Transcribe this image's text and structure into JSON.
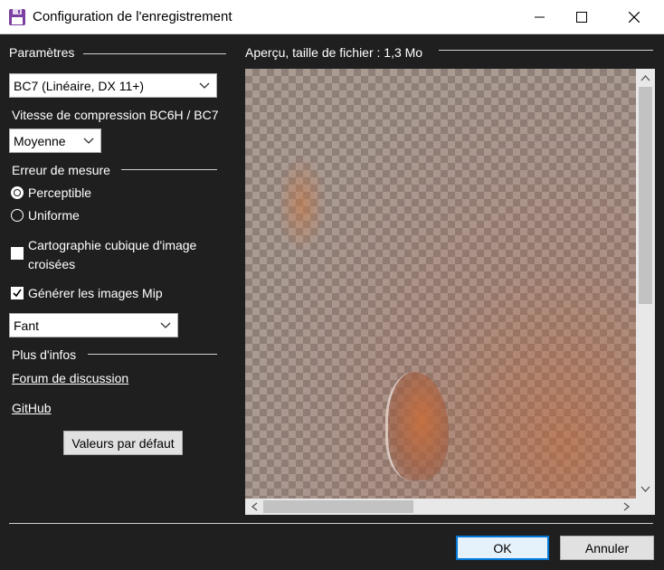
{
  "window": {
    "title": "Configuration de l'enregistrement"
  },
  "settings": {
    "group_title": "Paramètres",
    "format_select": "BC7 (Linéaire, DX 11+)",
    "speed_label": "Vitesse de compression BC6H / BC7",
    "speed_select": "Moyenne",
    "error_group_title": "Erreur de mesure",
    "error_options": [
      {
        "label": "Perceptible",
        "checked": true
      },
      {
        "label": "Uniforme",
        "checked": false
      }
    ],
    "cubemap_label_line1": "Cartographie cubique d'image",
    "cubemap_label_line2": "croisées",
    "cubemap_checked": false,
    "mip_label": "Générer les images Mip",
    "mip_checked": true,
    "filter_select": "Fant",
    "info_group_title": "Plus d'infos",
    "forum_link": "Forum de discussion",
    "github_link": "GitHub",
    "defaults_button": "Valeurs par défaut"
  },
  "preview": {
    "title": "Aperçu, taille de fichier : 1,3 Mo"
  },
  "footer": {
    "ok_label": "OK",
    "cancel_label": "Annuler"
  }
}
